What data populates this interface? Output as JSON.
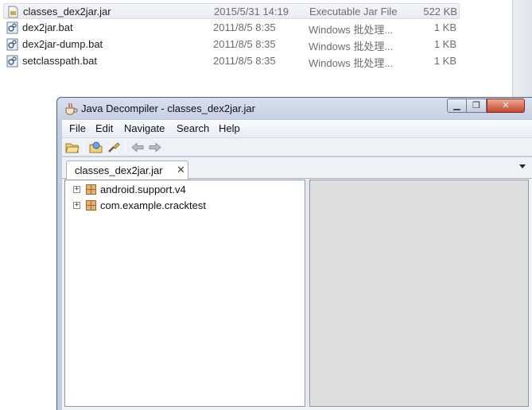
{
  "explorer": {
    "files": [
      {
        "name": "classes_dex2jar.jar",
        "date": "2015/5/31 14:19",
        "type": "Executable Jar File",
        "size": "522 KB",
        "icon": "jar-file-icon",
        "selected": true
      },
      {
        "name": "dex2jar.bat",
        "date": "2011/8/5 8:35",
        "type": "Windows 批处理...",
        "size": "1 KB",
        "icon": "batch-file-icon"
      },
      {
        "name": "dex2jar-dump.bat",
        "date": "2011/8/5 8:35",
        "type": "Windows 批处理...",
        "size": "1 KB",
        "icon": "batch-file-icon"
      },
      {
        "name": "setclasspath.bat",
        "date": "2011/8/5 8:35",
        "type": "Windows 批处理...",
        "size": "1 KB",
        "icon": "batch-file-icon"
      }
    ]
  },
  "window": {
    "title": "Java Decompiler - classes_dex2jar.jar",
    "minimize": "▁",
    "maximize": "❐",
    "close": "✕",
    "accent": "#c4cde0"
  },
  "menu": [
    "File",
    "Edit",
    "Navigate",
    "Search",
    "Help"
  ],
  "toolbar": [
    "open-folder-icon",
    "open-type-icon",
    "search-icon",
    "back-arrow-icon",
    "forward-arrow-icon"
  ],
  "tab": {
    "label": "classes_dex2jar.jar",
    "close": "✕"
  },
  "tree": {
    "nodes": [
      {
        "label": "android.support.v4",
        "expander": "+",
        "icon": "package-icon"
      },
      {
        "label": "com.example.cracktest",
        "expander": "+",
        "icon": "package-icon"
      }
    ]
  }
}
